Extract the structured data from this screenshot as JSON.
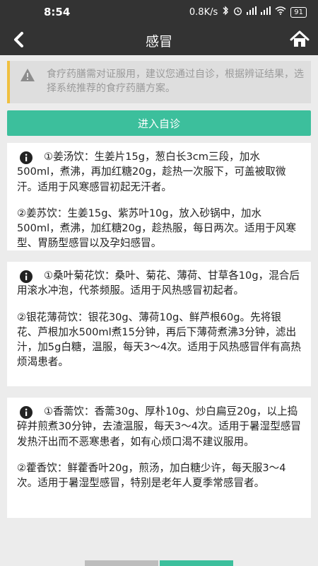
{
  "status_bar": {
    "time": "8:54",
    "network_speed": "0.8K/s",
    "battery": "91"
  },
  "nav": {
    "title": "感冒"
  },
  "notice": {
    "text": "食疗药膳需对证服用，建议您通过自诊，根据辨证结果，选择系统推荐的食疗药膳方案。"
  },
  "enter_button": {
    "label": "进入自诊"
  },
  "cards": [
    {
      "paragraphs": [
        "①姜汤饮：生姜片15g，葱白长3cm三段，加水500ml，煮沸，再加红糖20g，趁热一次服下，可盖被取微汗。适用于风寒感冒初起无汗者。",
        "②姜苏饮：生姜15g、紫苏叶10g，放入砂锅中，加水500ml，煮沸，加红糖20g，趁热服，每日两次。适用于风寒型、胃肠型感冒以及孕妇感冒。"
      ]
    },
    {
      "paragraphs": [
        "①桑叶菊花饮：桑叶、菊花、薄荷、甘草各10g，混合后用滚水冲泡，代茶频服。适用于风热感冒初起者。",
        "②银花薄荷饮：银花30g、薄荷10g、鲜芦根60g。先将银花、芦根加水500ml煮15分钟，再后下薄荷煮沸3分钟，滤出汁，加5g白糖，温服，每天3～4次。适用于风热感冒伴有高热烦渴患者。"
      ]
    },
    {
      "paragraphs": [
        "①香薷饮：香薷30g、厚朴10g、炒白扁豆20g，以上捣碎并煎煮30分钟，去渣温服，每天3～4次。适用于暑湿型感冒发热汗出而不恶寒患者，如有心烦口渴不建议服用。",
        "②藿香饮：鲜藿香叶20g，煎汤，加白糖少许，每天服3～4次。适用于暑湿型感冒，特别是老年人夏季常感冒者。"
      ]
    }
  ],
  "colors": {
    "accent": "#3cbf9c",
    "header": "#333333",
    "notice_border": "#f0c040",
    "background": "#ececec"
  },
  "icons": [
    "back-arrow-icon",
    "home-icon",
    "warning-icon",
    "info-icon",
    "bluetooth-icon",
    "wifi-icon",
    "signal-icon",
    "battery-icon"
  ]
}
